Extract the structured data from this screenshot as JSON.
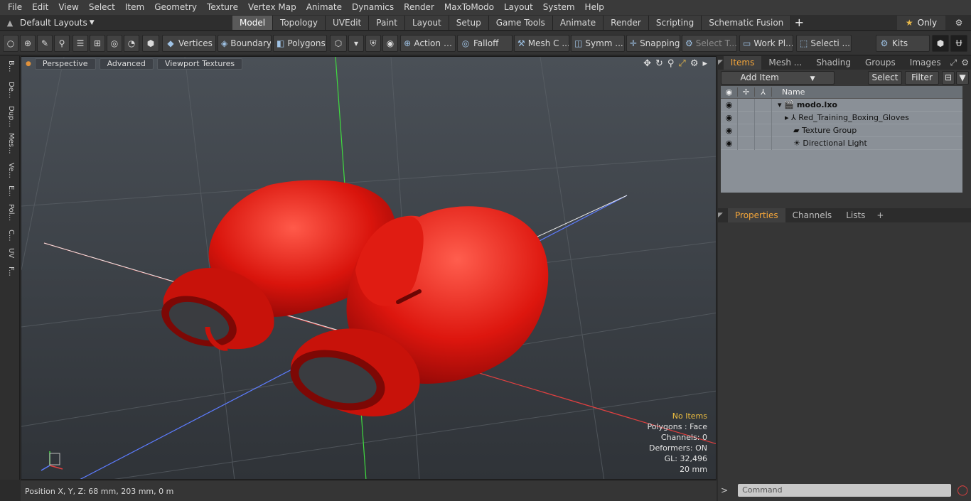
{
  "menu": [
    "File",
    "Edit",
    "View",
    "Select",
    "Item",
    "Geometry",
    "Texture",
    "Vertex Map",
    "Animate",
    "Dynamics",
    "Render",
    "MaxToModo",
    "Layout",
    "System",
    "Help"
  ],
  "layouts_label": "Default Layouts",
  "tabs": [
    "Model",
    "Topology",
    "UVEdit",
    "Paint",
    "Layout",
    "Setup",
    "Game Tools",
    "Animate",
    "Render",
    "Scripting",
    "Schematic Fusion"
  ],
  "active_tab": "Model",
  "only_label": "Only",
  "toolbar": {
    "vertices": "Vertices",
    "boundary": "Boundary",
    "polygons": "Polygons",
    "action": "Action",
    "falloff": "Falloff",
    "meshc": "Mesh C ...",
    "symm": "Symm ...",
    "snapping": "Snapping",
    "selectt": "Select T...",
    "workpl": "Work Pl...",
    "selecti": "Selecti ...",
    "kits": "Kits"
  },
  "left_tabs": [
    "B...",
    "De...",
    "Dup...",
    "Mes...",
    "Ve...",
    "E...",
    "Pol...",
    "C...",
    "UV",
    "F..."
  ],
  "viewport": {
    "perspective": "Perspective",
    "advanced": "Advanced",
    "textures": "Viewport Textures",
    "stats": {
      "no_items": "No Items",
      "polygons": "Polygons : Face",
      "channels": "Channels: 0",
      "deformers": "Deformers: ON",
      "gl": "GL: 32,496",
      "scale": "20 mm"
    }
  },
  "status": {
    "position": "Position X, Y, Z:   68 mm, 203 mm, 0 m"
  },
  "right_panel": {
    "tabs": [
      "Items",
      "Mesh ...",
      "Shading",
      "Groups",
      "Images"
    ],
    "add_item": "Add Item",
    "select": "Select",
    "filter": "Filter",
    "name_col": "Name",
    "items": [
      {
        "label": "modo.lxo"
      },
      {
        "label": "Red_Training_Boxing_Gloves"
      },
      {
        "label": "Texture Group"
      },
      {
        "label": "Directional Light"
      }
    ],
    "lower_tabs": [
      "Properties",
      "Channels",
      "Lists"
    ],
    "command_placeholder": "Command"
  }
}
